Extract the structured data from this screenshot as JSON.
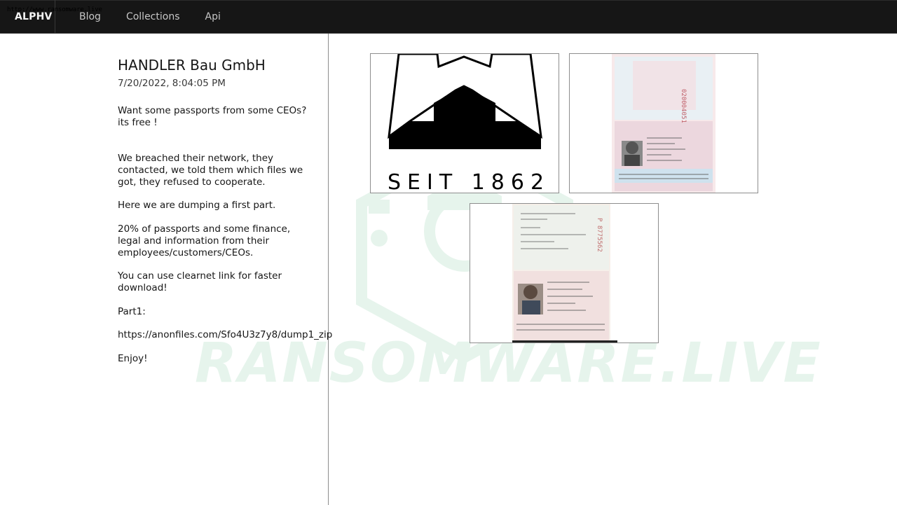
{
  "browser": {
    "url": "http://www.ransomware.live"
  },
  "nav": {
    "brand": "ALPHV",
    "items": [
      {
        "label": "Blog"
      },
      {
        "label": "Collections"
      },
      {
        "label": "Api"
      }
    ]
  },
  "watermark": {
    "text": "RANSOMWARE.LIVE"
  },
  "post": {
    "title": "HANDLER Bau GmbH",
    "date": "7/20/2022, 8:04:05 PM",
    "paragraphs": [
      "Want some passports from some CEOs?\nits free !",
      "We breached their network, they contacted, we told them which files we got, they refused to cooperate.",
      "Here we are dumping a first part.",
      "20% of passports and some finance, legal and information from their employees/customers/CEOs.",
      "You can use clearnet link for faster download!",
      "Part1:",
      "https://anonfiles.com/Sfo4U3z7y8/dump1_zip",
      "Enjoy!"
    ]
  },
  "gallery": {
    "logo_text": "SEIT 1862",
    "images": [
      {
        "alt": "company-logo"
      },
      {
        "alt": "passport-scan-1"
      },
      {
        "alt": "passport-scan-2"
      }
    ]
  },
  "colors": {
    "nav_bg": "#161616",
    "watermark": "#e6f4ec",
    "border": "#8d8d8d"
  }
}
